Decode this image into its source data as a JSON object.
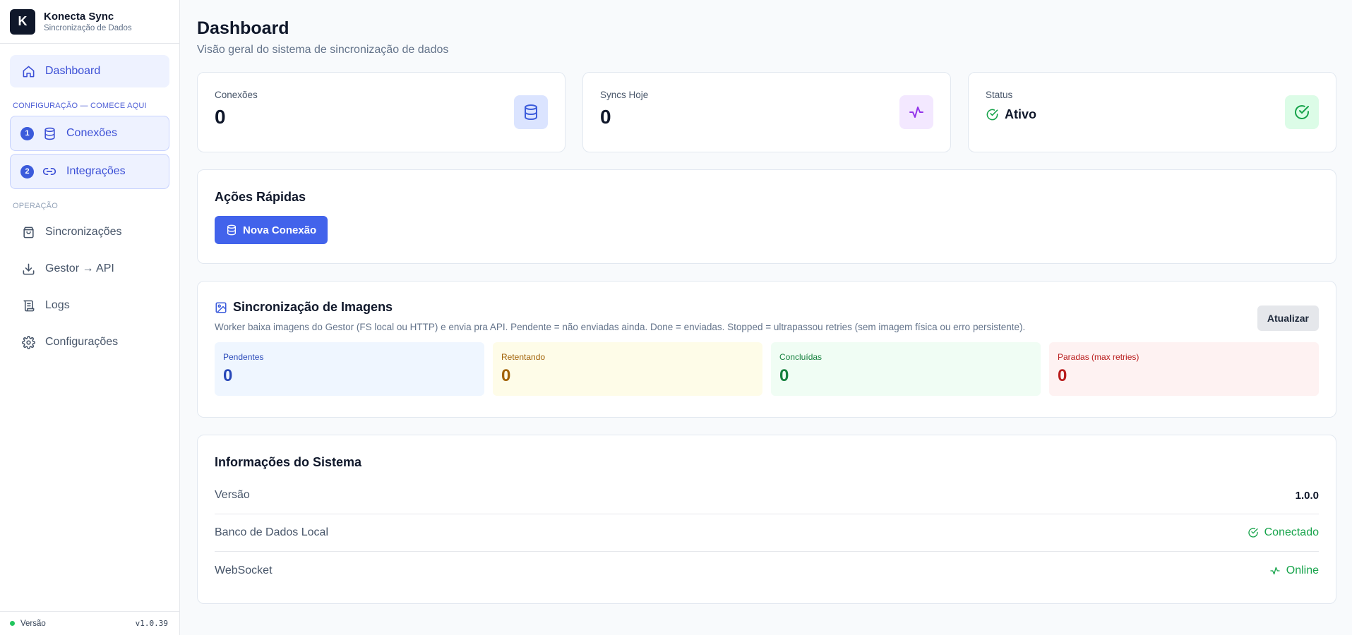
{
  "sidebar": {
    "brand": {
      "logo": "K",
      "title": "Konecta Sync",
      "subtitle": "Sincronização de Dados"
    },
    "dashboard": {
      "label": "Dashboard",
      "icon": "home-icon"
    },
    "config_section": "CONFIGURAÇÃO — COMECE AQUI",
    "config_items": [
      {
        "num": "1",
        "label": "Conexões",
        "icon": "database-icon"
      },
      {
        "num": "2",
        "label": "Integrações",
        "icon": "link-icon"
      }
    ],
    "op_section": "OPERAÇÃO",
    "op_items": [
      {
        "label": "Sincronizações",
        "icon": "package-icon"
      },
      {
        "label": "Gestor → API",
        "icon": "download-icon"
      },
      {
        "label": "Logs",
        "icon": "scroll-icon"
      },
      {
        "label": "Configurações",
        "icon": "gear-icon"
      }
    ],
    "footer": {
      "label": "Versão",
      "version": "v1.0.39"
    }
  },
  "header": {
    "title": "Dashboard",
    "subtitle": "Visão geral do sistema de sincronização de dados"
  },
  "stats": {
    "connections": {
      "label": "Conexões",
      "value": "0",
      "icon": "database-icon",
      "color": "#3b5bdb"
    },
    "syncs": {
      "label": "Syncs Hoje",
      "value": "0",
      "icon": "activity-icon",
      "color": "#9333ea"
    },
    "status": {
      "label": "Status",
      "value": "Ativo",
      "icon": "check-circle-icon",
      "color": "#16a34a"
    }
  },
  "quick_actions": {
    "title": "Ações Rápidas",
    "new_connection": "Nova Conexão"
  },
  "images": {
    "title": "Sincronização de Imagens",
    "description": "Worker baixa imagens do Gestor (FS local ou HTTP) e envia pra API. Pendente = não enviadas ainda. Done = enviadas. Stopped = ultrapassou retries (sem imagem física ou erro persistente).",
    "refresh": "Atualizar",
    "queues": [
      {
        "label": "Pendentes",
        "value": "0"
      },
      {
        "label": "Retentando",
        "value": "0"
      },
      {
        "label": "Concluídas",
        "value": "0"
      },
      {
        "label": "Paradas (max retries)",
        "value": "0"
      }
    ]
  },
  "system": {
    "title": "Informações do Sistema",
    "version": {
      "label": "Versão",
      "value": "1.0.0"
    },
    "database": {
      "label": "Banco de Dados Local",
      "value": "Conectado"
    },
    "websocket": {
      "label": "WebSocket",
      "value": "Online"
    }
  }
}
